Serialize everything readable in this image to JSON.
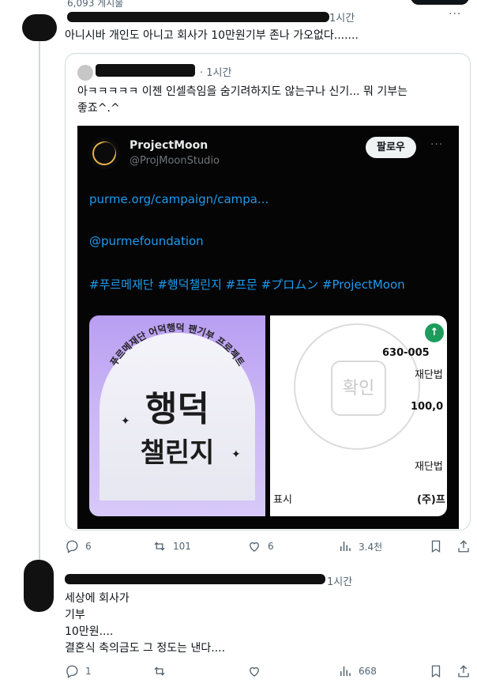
{
  "header": {
    "post_count": "6,093 게시물"
  },
  "reply1": {
    "time": "1시간",
    "text": "아니시바 개인도 아니고 회사가 10만원기부 존나 가오없다.......",
    "quote": {
      "time": "· 1시간",
      "text_line1": "아ㅋㅋㅋㅋㅋ 이젠 인셀측임을 숨기려하지도 않는구나 신기... 뭐 기부는",
      "text_line2": "좋죠^.^",
      "embed": {
        "name": "ProjectMoon",
        "handle": "@ProjMoonStudio",
        "follow_label": "팔로우",
        "link": "purme.org/campaign/campa...",
        "mention": "@purmefoundation",
        "hashtags": "#푸르메재단 #행덕챌린지 #프문 #プロムン #ProjectMoon",
        "image_left": {
          "arc_text": "푸르메재단 어덕행덕 팬기부 프로젝트",
          "title1": "행덕",
          "title2": "챌린지"
        },
        "image_right": {
          "stamp_text": "확인",
          "line1": "630-005",
          "line2": "재단법",
          "line3": "100,0",
          "line4": "재단법",
          "line5": "표시",
          "line6": "(주)프"
        }
      }
    },
    "actions": {
      "replies": "6",
      "reposts": "101",
      "likes": "6",
      "views": "3.4천"
    }
  },
  "reply2": {
    "time": "1시간",
    "lines": [
      "세상에 회사가",
      "기부",
      "10만원....",
      "결혼식 축의금도 그 정도는 낸다...."
    ],
    "actions": {
      "replies": "1",
      "reposts": "",
      "likes": "",
      "views": "668"
    }
  },
  "colors": {
    "accent": "#1d9bf0",
    "text": "#0f1419",
    "muted": "#536471",
    "embed_bg": "#050505"
  },
  "icons": [
    "reply-icon",
    "repost-icon",
    "like-icon",
    "views-icon",
    "bookmark-icon",
    "share-icon",
    "more-icon"
  ]
}
